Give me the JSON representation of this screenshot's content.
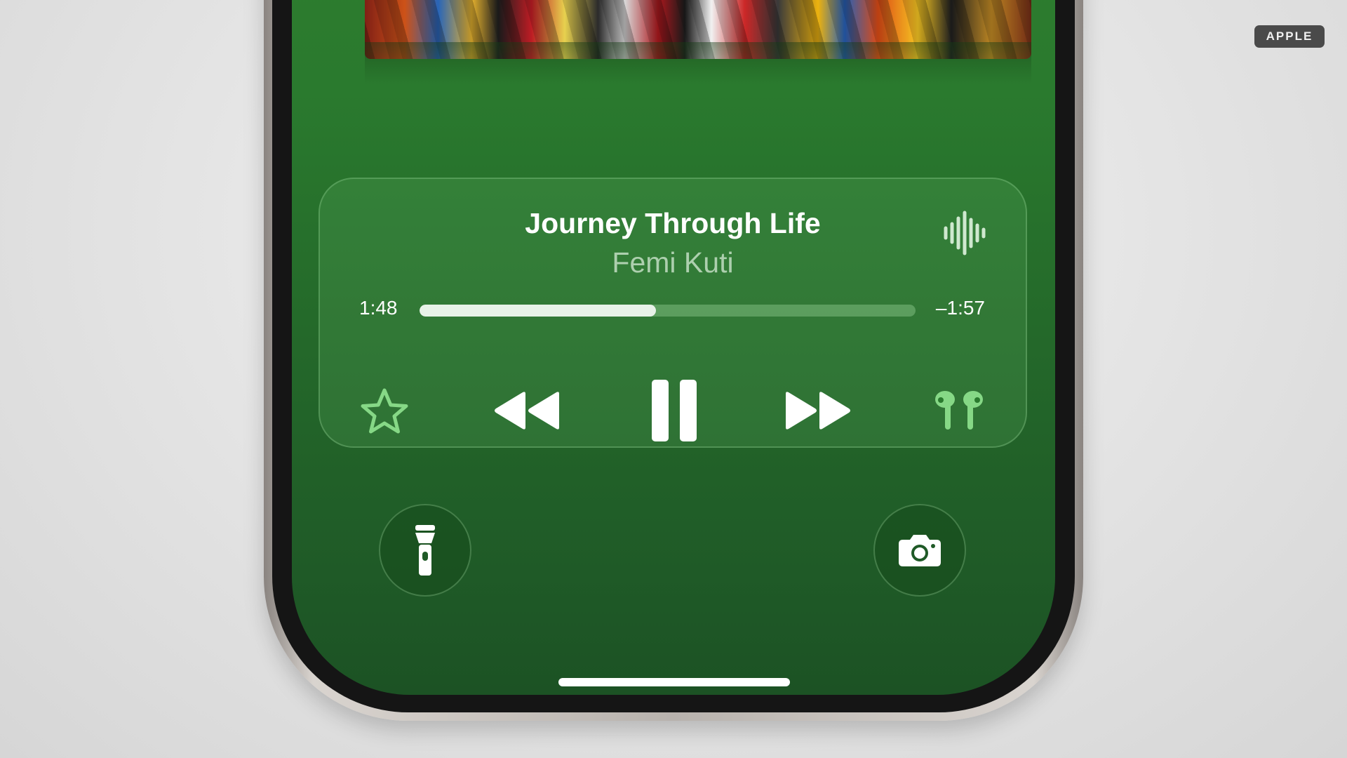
{
  "badge": {
    "label": "APPLE"
  },
  "now_playing": {
    "title": "Journey Through Life",
    "artist": "Femi Kuti",
    "elapsed": "1:48",
    "remaining": "–1:57",
    "progress_fraction": 0.477
  },
  "controls": {
    "favorite_icon": "star-icon",
    "rewind_icon": "rewind-icon",
    "pause_icon": "pause-icon",
    "forward_icon": "fast-forward-icon",
    "output_icon": "airpods-icon",
    "audio_icon": "waveform-icon"
  },
  "quick_actions": {
    "left_icon": "flashlight-icon",
    "right_icon": "camera-icon"
  },
  "colors": {
    "screen_green": "#2a7a2e",
    "accent_light_green": "#7fd67f",
    "badge_bg": "#4a4a4a"
  }
}
